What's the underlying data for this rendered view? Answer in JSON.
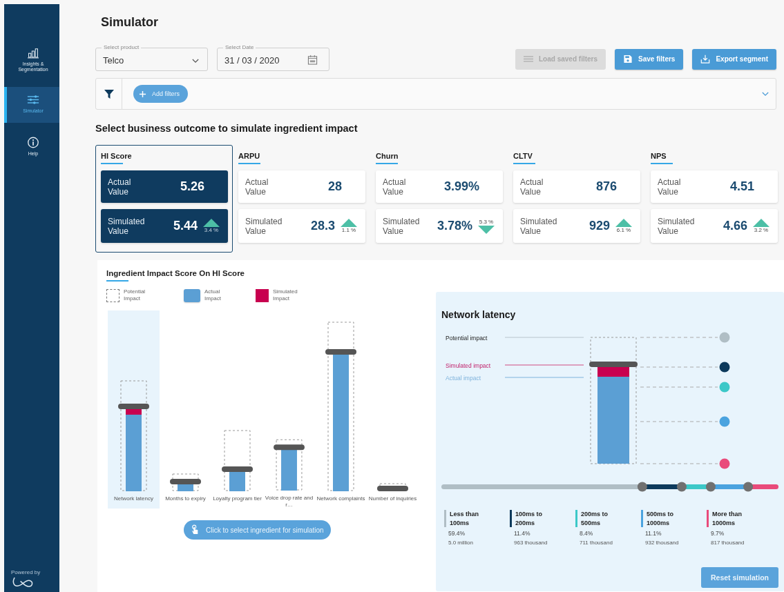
{
  "sidebar": {
    "items": [
      {
        "label": "Insights & Segmentation",
        "selected": false
      },
      {
        "label": "Simulator",
        "selected": true
      },
      {
        "label": "Help",
        "selected": false
      }
    ],
    "footer": "Powered by"
  },
  "page_title": "Simulator",
  "filters": {
    "product": {
      "label": "Select product",
      "value": "Telco"
    },
    "date": {
      "label": "Select Date",
      "value": "31 / 03 / 2020"
    },
    "add_filters": "Add filters"
  },
  "actions": [
    {
      "label": "Load saved filters",
      "disabled": true
    },
    {
      "label": "Save filters",
      "disabled": false
    },
    {
      "label": "Export segment",
      "disabled": false
    }
  ],
  "outcomes_heading": "Select business outcome to simulate ingredient impact",
  "outcomes": [
    {
      "label": "HI Score",
      "selected": true,
      "kind": "up",
      "actual": {
        "label": "Actual Value",
        "value": "5.26"
      },
      "simulated": {
        "label": "Simulated Value",
        "value": "5.44",
        "change": "3.4 %"
      }
    },
    {
      "label": "ARPU",
      "selected": false,
      "kind": "up",
      "actual": {
        "label": "Actual Value",
        "value": "28"
      },
      "simulated": {
        "label": "Simulated Value",
        "value": "28.3",
        "change": "1.1 %"
      }
    },
    {
      "label": "Churn",
      "selected": false,
      "kind": "down",
      "actual": {
        "label": "Actual Value",
        "value": "3.99%"
      },
      "simulated": {
        "label": "Simulated Value",
        "value": "3.78%",
        "change": "5.3 %"
      }
    },
    {
      "label": "CLTV",
      "selected": false,
      "kind": "up",
      "actual": {
        "label": "Actual Value",
        "value": "876"
      },
      "simulated": {
        "label": "Simulated Value",
        "value": "929",
        "change": "6.1 %"
      }
    },
    {
      "label": "NPS",
      "selected": false,
      "kind": "up",
      "actual": {
        "label": "Actual Value",
        "value": "4.51"
      },
      "simulated": {
        "label": "Simulated Value",
        "value": "4.66",
        "change": "3.2 %"
      }
    }
  ],
  "impact_chart": {
    "title": "Ingredient Impact Score On HI Score",
    "legend": [
      {
        "label": "Potential Impact",
        "kind": "potential"
      },
      {
        "label": "Actual Impact",
        "kind": "actual"
      },
      {
        "label": "Simulated Impact",
        "kind": "simulated"
      }
    ],
    "ingredients": [
      {
        "label": "Network latency",
        "selected": true
      },
      {
        "label": "Months to expiry",
        "selected": false
      },
      {
        "label": "Loyalty program tier",
        "selected": false
      },
      {
        "label": "Voice drop rate and r…",
        "selected": false
      },
      {
        "label": "Network complaints",
        "selected": false
      },
      {
        "label": "Number of inquiries",
        "selected": false
      }
    ],
    "select_button": "Click to select ingredient for simulation"
  },
  "detail": {
    "title": "Network latency",
    "legend": [
      "Potential impact",
      "Simulated impact",
      "Actual impact"
    ],
    "buckets": [
      {
        "label": "Less than 100ms",
        "share": "59.4%",
        "count": "5.0 million",
        "color": "#b0bec5"
      },
      {
        "label": "100ms to 200ms",
        "share": "11.4%",
        "count": "963 thousand",
        "color": "#0d3a5c"
      },
      {
        "label": "200ms to 500ms",
        "share": "8.4%",
        "count": "711 thousand",
        "color": "#3cc8c8"
      },
      {
        "label": "500ms to 1000ms",
        "share": "11.1%",
        "count": "932 thousand",
        "color": "#4aa3df"
      },
      {
        "label": "More than 1000ms",
        "share": "9.7%",
        "count": "817 thousand",
        "color": "#e94b7b"
      }
    ],
    "reset_button": "Reset simulation"
  }
}
